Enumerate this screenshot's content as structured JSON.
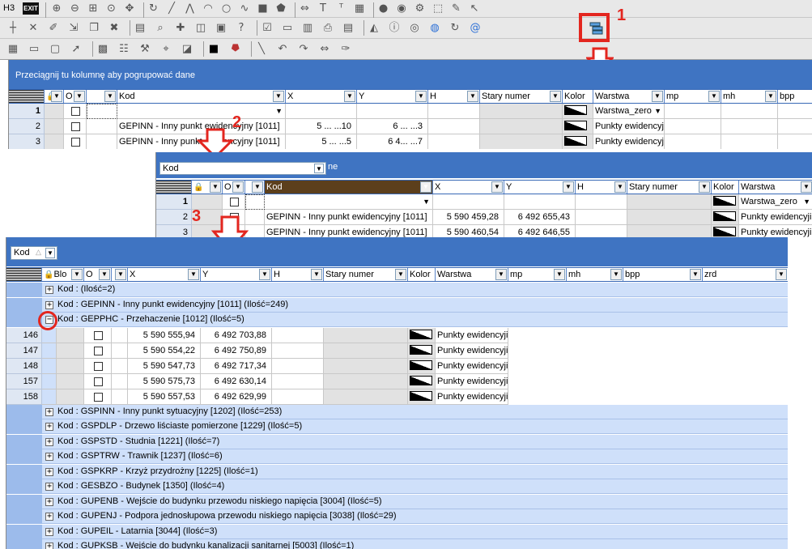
{
  "toolbar": {
    "h3_label": "H3",
    "exit_label": "EXIT",
    "row1_icons": [
      "zoom-in-icon",
      "zoom-out-icon",
      "zoom-window-icon",
      "zoom-previous-icon",
      "pan-icon",
      "refresh-icon",
      "line-icon",
      "polyline-icon",
      "arc-icon",
      "circle-icon",
      "curve-icon",
      "rectangle-icon",
      "polygon-icon",
      "measure-icon",
      "text-icon",
      "label-icon",
      "table-icon",
      "point-icon",
      "zoom-icon",
      "settings-icon",
      "selection-icon",
      "pencil-icon",
      "cursor-icon"
    ],
    "row2_icons": [
      "snap-icon",
      "cross-icon",
      "edit-icon",
      "move-icon",
      "copy-icon",
      "delete-icon",
      "grid-icon",
      "search-icon",
      "add-icon",
      "layer-icon",
      "map-icon",
      "help-icon",
      "checkbox-icon",
      "window-icon",
      "table-view-icon",
      "print-icon",
      "document-icon",
      "chart-icon",
      "info-icon",
      "group-icon",
      "circle-target-icon",
      "globe-icon",
      "refresh-icon",
      "at-icon"
    ],
    "row3_icons": [
      "dock-icon",
      "window-icon",
      "window2-icon",
      "pointer-icon",
      "calc-icon",
      "list-icon",
      "tool-icon",
      "gps-icon",
      "layers-icon",
      "color-square-icon",
      "map-pin-icon",
      "ruler-icon",
      "undo-icon",
      "redo-icon",
      "measure-icon",
      "sketch-icon"
    ]
  },
  "markers": {
    "m1": "1",
    "m2": "2",
    "m3": "3"
  },
  "panel1": {
    "group_hint": "Przeciągnij tu kolumnę aby pogrupować dane",
    "columns": [
      "",
      "",
      "O",
      "",
      "Kod",
      "X",
      "Y",
      "H",
      "Stary numer",
      "Kolor",
      "Warstwa",
      "mp",
      "mh",
      "bpp"
    ],
    "rows": [
      {
        "n": "1",
        "kod": "",
        "x": "",
        "y": "",
        "warstwa": "Warstwa_zero"
      },
      {
        "n": "2",
        "kod": "GEPINN - Inny punkt ewidencyjny [1011]",
        "x": "5 ... ...10",
        "y": "6 ... ...3",
        "warstwa": "Punkty ewidencyji"
      },
      {
        "n": "3",
        "kod": "GEPINN - Inny punkt ewidencyjny [1011]",
        "x": "5 ... ...5",
        "y": "6 4... ...7",
        "warstwa": "Punkty ewidencyji"
      }
    ]
  },
  "panel2": {
    "group_chip": "Kod",
    "group_hint_tail": "ne",
    "columns": [
      "",
      "",
      "O",
      "",
      "Kod",
      "X",
      "Y",
      "H",
      "Stary numer",
      "Kolor",
      "Warstwa"
    ],
    "rows": [
      {
        "n": "1",
        "kod": "",
        "x": "",
        "y": "",
        "warstwa": "Warstwa_zero"
      },
      {
        "n": "2",
        "kod": "GEPINN - Inny punkt ewidencyjny [1011]",
        "x": "5 590 459,28",
        "y": "6 492 655,43",
        "warstwa": "Punkty ewidencyji"
      },
      {
        "n": "3",
        "kod": "GEPINN - Inny punkt ewidencyjny [1011]",
        "x": "5 590 460,54",
        "y": "6 492 646,55",
        "warstwa": "Punkty ewidencyji"
      }
    ]
  },
  "panel3": {
    "group_chip": "Kod",
    "columns": [
      "",
      "Blo",
      "O",
      "",
      "X",
      "Y",
      "H",
      "Stary numer",
      "Kolor",
      "Warstwa",
      "mp",
      "mh",
      "bpp",
      "zrd"
    ],
    "groups_top": [
      {
        "label": "Kod : (Ilość=2)",
        "state": "+"
      },
      {
        "label": "Kod : GEPINN - Inny punkt ewidencyjny [1011] (Ilość=249)",
        "state": "+"
      },
      {
        "label": "Kod : GEPPHC - Przehaczenie [1012] (Ilość=5)",
        "state": "−"
      }
    ],
    "rows": [
      {
        "n": "146",
        "x": "5 590 555,94",
        "y": "6 492 703,88",
        "warstwa": "Punkty ewidencyji"
      },
      {
        "n": "147",
        "x": "5 590 554,22",
        "y": "6 492 750,89",
        "warstwa": "Punkty ewidencyji"
      },
      {
        "n": "148",
        "x": "5 590 547,73",
        "y": "6 492 717,34",
        "warstwa": "Punkty ewidencyji"
      },
      {
        "n": "157",
        "x": "5 590 575,73",
        "y": "6 492 630,14",
        "warstwa": "Punkty ewidencyji"
      },
      {
        "n": "158",
        "x": "5 590 557,53",
        "y": "6 492 629,99",
        "warstwa": "Punkty ewidencyji"
      }
    ],
    "groups_bottom": [
      {
        "label": "Kod : GSPINN - Inny punkt sytuacyjny [1202] (Ilość=253)"
      },
      {
        "label": "Kod : GSPDLP - Drzewo liściaste pomierzone [1229] (Ilość=5)"
      },
      {
        "label": "Kod : GSPSTD - Studnia [1221] (Ilość=7)"
      },
      {
        "label": "Kod : GSPTRW - Trawnik [1237] (Ilość=6)"
      },
      {
        "label": "Kod : GSPKRP - Krzyż przydrożny [1225] (Ilość=1)"
      },
      {
        "label": "Kod : GESBZO - Budynek [1350] (Ilość=4)"
      },
      {
        "label": "Kod : GUPENB - Wejście do budynku przewodu niskiego napięcia [3004] (Ilość=5)"
      },
      {
        "label": "Kod : GUPENJ - Podpora jednosłupowa przewodu niskiego napięcia [3038] (Ilość=29)"
      },
      {
        "label": "Kod : GUPEIL - Latarnia [3044] (Ilość=3)"
      },
      {
        "label": "Kod : GUPKSB - Wejście do budynku kanalizacji sanitarnej [5003] (Ilość=1)"
      }
    ]
  }
}
